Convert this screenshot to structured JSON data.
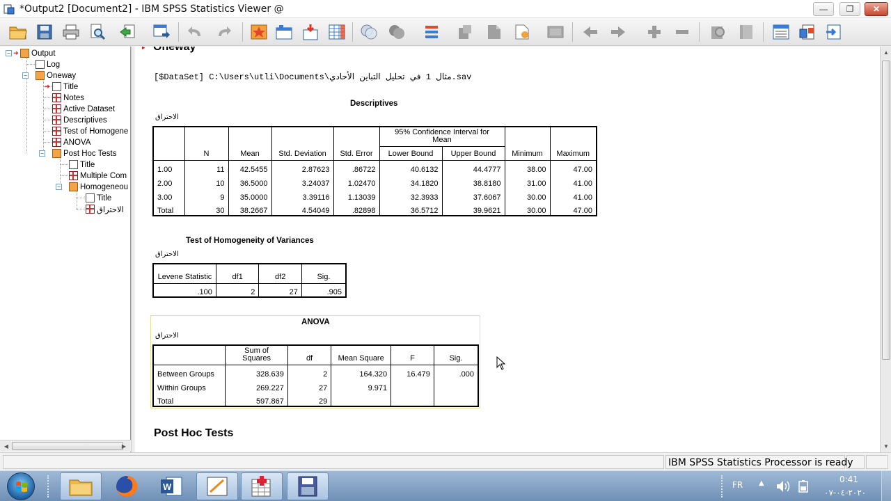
{
  "window": {
    "title": "*Output2 [Document2] - IBM SPSS Statistics Viewer @",
    "controls": [
      "minimize",
      "restore",
      "close"
    ]
  },
  "toolbar": {
    "icons": [
      "open-icon",
      "save-icon",
      "print-icon",
      "print-preview-icon",
      "export-icon",
      "recall-dialog-icon",
      "undo-icon",
      "redo-icon",
      "goto-case-icon",
      "goto-variable-icon",
      "variables-icon",
      "insert-table-icon",
      "pivot-icon",
      "select-cases-icon",
      "weight-icon",
      "value-labels-icon",
      "show-all-icon",
      "designate-window-icon",
      "promote-icon",
      "demote-icon",
      "expand-icon",
      "collapse-icon",
      "show-icon",
      "hide-icon",
      "insert-heading-icon",
      "insert-title-icon",
      "insert-text-icon"
    ]
  },
  "nav_tree": {
    "output": "Output",
    "log": "Log",
    "oneway": "Oneway",
    "title1": "Title",
    "notes": "Notes",
    "active_dataset": "Active Dataset",
    "descriptives": "Descriptives",
    "test_homogeneity": "Test of Homogene",
    "anova": "ANOVA",
    "post_hoc_tests": "Post Hoc Tests",
    "title2": "Title",
    "multiple_com": "Multiple Com",
    "homogeneous": "Homogeneou",
    "title3": "Title",
    "ihtiraq": "الاحتراق"
  },
  "content": {
    "oneway_heading": "Oneway",
    "dataset_line": "[$DataSet] C:\\Users\\utli\\Documents\\مثال 1 في تحليل التباين الأحادي.sav",
    "descriptives": {
      "title": "Descriptives",
      "dependent_var": "الاحتراق",
      "headers": {
        "n": "N",
        "mean": "Mean",
        "std_dev": "Std. Deviation",
        "std_err": "Std. Error",
        "ci": "95% Confidence Interval for Mean",
        "lower": "Lower Bound",
        "upper": "Upper Bound",
        "min": "Minimum",
        "max": "Maximum"
      },
      "rows": [
        {
          "label": "1.00",
          "n": "11",
          "mean": "42.5455",
          "sd": "2.87623",
          "se": ".86722",
          "lb": "40.6132",
          "ub": "44.4777",
          "min": "38.00",
          "max": "47.00"
        },
        {
          "label": "2.00",
          "n": "10",
          "mean": "36.5000",
          "sd": "3.24037",
          "se": "1.02470",
          "lb": "34.1820",
          "ub": "38.8180",
          "min": "31.00",
          "max": "41.00"
        },
        {
          "label": "3.00",
          "n": "9",
          "mean": "35.0000",
          "sd": "3.39116",
          "se": "1.13039",
          "lb": "32.3933",
          "ub": "37.6067",
          "min": "30.00",
          "max": "41.00"
        },
        {
          "label": "Total",
          "n": "30",
          "mean": "38.2667",
          "sd": "4.54049",
          "se": ".82898",
          "lb": "36.5712",
          "ub": "39.9621",
          "min": "30.00",
          "max": "47.00"
        }
      ]
    },
    "homogeneity": {
      "title": "Test of Homogeneity of Variances",
      "dependent_var": "الاحتراق",
      "headers": {
        "levene": "Levene Statistic",
        "df1": "df1",
        "df2": "df2",
        "sig": "Sig."
      },
      "row": {
        "levene": ".100",
        "df1": "2",
        "df2": "27",
        "sig": ".905"
      }
    },
    "anova": {
      "title": "ANOVA",
      "dependent_var": "الاحتراق",
      "headers": {
        "ss": "Sum of Squares",
        "df": "df",
        "ms": "Mean Square",
        "f": "F",
        "sig": "Sig."
      },
      "rows": [
        {
          "label": "Between Groups",
          "ss": "328.639",
          "df": "2",
          "ms": "164.320",
          "f": "16.479",
          "sig": ".000"
        },
        {
          "label": "Within Groups",
          "ss": "269.227",
          "df": "27",
          "ms": "9.971",
          "f": "",
          "sig": ""
        },
        {
          "label": "Total",
          "ss": "597.867",
          "df": "29",
          "ms": "",
          "f": "",
          "sig": ""
        }
      ]
    },
    "post_hoc_heading": "Post Hoc Tests"
  },
  "status": {
    "processor": "IBM SPSS Statistics Processor is ready"
  },
  "taskbar": {
    "language": "FR",
    "time": "0:41",
    "date": "٢٠٢٠-٠٤-٠٧",
    "apps": [
      "explorer-icon",
      "firefox-icon",
      "word-icon",
      "spss-icon",
      "spss-output-icon",
      "spss-data-icon"
    ]
  },
  "colors": {
    "title_bar": "#ffffff",
    "toolbar": "#e9e9e9",
    "taskbar": "#7f9dc2",
    "anova_frame": "#e8dc9a"
  }
}
